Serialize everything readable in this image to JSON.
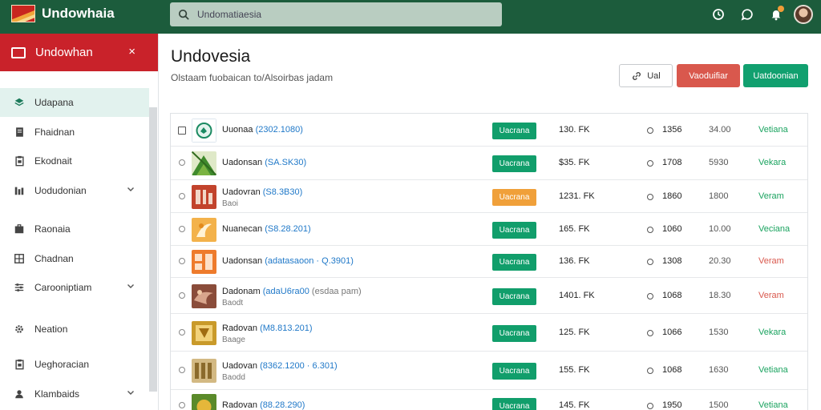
{
  "app": {
    "brand": "Undowhaia",
    "colors": {
      "topbar": "#1c5c3c",
      "sidebar_header": "#c9222a",
      "accent_green": "#11a06f",
      "accent_orange": "#f0a03a",
      "accent_red": "#d9584d"
    }
  },
  "search": {
    "value": "Undomatiaesia",
    "placeholder": "Undomatiaesia"
  },
  "topbar_icons": [
    "clock-icon",
    "chat-icon",
    "bell-icon"
  ],
  "sidebar": {
    "title": "Undowhan",
    "close": "×",
    "items": [
      {
        "label": "Udapana",
        "icon": "layers-icon",
        "active": true,
        "chevron": false
      },
      {
        "label": "Fhaidnan",
        "icon": "document-icon",
        "active": false,
        "chevron": false
      },
      {
        "label": "Ekodnait",
        "icon": "clipboard-icon",
        "active": false,
        "chevron": false
      },
      {
        "label": "Uodudonian",
        "icon": "bar-chart-icon",
        "active": false,
        "chevron": true
      },
      {
        "label": "Raonaia",
        "icon": "briefcase-icon",
        "active": false,
        "chevron": false
      },
      {
        "label": "Chadnan",
        "icon": "grid-icon",
        "active": false,
        "chevron": false
      },
      {
        "label": "Carooniptiam",
        "icon": "sliders-icon",
        "active": false,
        "chevron": true
      },
      {
        "label": "Neation",
        "icon": "gear-icon",
        "active": false,
        "chevron": false
      },
      {
        "label": "Ueghoracian",
        "icon": "clipboard-icon",
        "active": false,
        "chevron": false
      },
      {
        "label": "Klambaids",
        "icon": "user-icon",
        "active": false,
        "chevron": true
      }
    ]
  },
  "main": {
    "title": "Undovesia",
    "subtitle": "Olstaam fuobaican to/Alsoirbas jadam",
    "buttons": {
      "outline": "Ual",
      "red": "Vaoduifiar",
      "green": "Uatdoonian"
    }
  },
  "table": {
    "rows": [
      {
        "name": "Uuonaa",
        "code": "(2302.1080)",
        "tag": "",
        "status": "Uacrana",
        "status_color": "#119e6b",
        "price": "130. FK",
        "qty": "1356",
        "value": "34.00",
        "action": "Vetiana",
        "action_color": "#1aa35f",
        "thumb": "circle-logo"
      },
      {
        "name": "Uadonsan",
        "code": "(SA.SK30)",
        "tag": "",
        "status": "Uacrana",
        "status_color": "#119e6b",
        "price": "$35. FK",
        "qty": "1708",
        "value": "5930",
        "action": "Vekara",
        "action_color": "#1aa35f",
        "thumb": "green-tree"
      },
      {
        "name": "Uadovran",
        "code": "(S8.3B30)",
        "tag": "Baoi",
        "status": "Uacrana",
        "status_color": "#f0a03a",
        "price": "1231. FK",
        "qty": "1860",
        "value": "1800",
        "action": "Veram",
        "action_color": "#1aa35f",
        "thumb": "red-pattern"
      },
      {
        "name": "Nuanecan",
        "code": "(S8.28.201)",
        "tag": "",
        "status": "Uacrana",
        "status_color": "#119e6b",
        "price": "165. FK",
        "qty": "1060",
        "value": "10.00",
        "action": "Veciana",
        "action_color": "#1aa35f",
        "thumb": "orange-swirl"
      },
      {
        "name": "Uadonsan",
        "code": "(adatasaoon · Q.3901)",
        "tag": "",
        "status": "Uacrana",
        "status_color": "#119e6b",
        "price": "136. FK",
        "qty": "1308",
        "value": "20.30",
        "action": "Veram",
        "action_color": "#d9584d",
        "thumb": "orange-pattern"
      },
      {
        "name": "Dadonam",
        "code": "(adaU6ra00",
        "tag": "Baodt",
        "extra": "(esdaa pam)",
        "status": "Uacrana",
        "status_color": "#119e6b",
        "price": "1401. FK",
        "qty": "1068",
        "value": "18.30",
        "action": "Veram",
        "action_color": "#d9584d",
        "thumb": "brown-art"
      },
      {
        "name": "Radovan",
        "code": "(M8.813.201)",
        "tag": "Baage",
        "status": "Uacrana",
        "status_color": "#119e6b",
        "price": "125. FK",
        "qty": "1066",
        "value": "1530",
        "action": "Vekara",
        "action_color": "#1aa35f",
        "thumb": "gold-tile"
      },
      {
        "name": "Uadovan",
        "code": "(8362.1200 · 6.301)",
        "tag": "Baodd",
        "status": "Uacrana",
        "status_color": "#119e6b",
        "price": "155. FK",
        "qty": "1068",
        "value": "1630",
        "action": "Vetiana",
        "action_color": "#1aa35f",
        "thumb": "gold-bars"
      },
      {
        "name": "Radovan",
        "code": "(88.28.290)",
        "tag": "",
        "status": "Uacrana",
        "status_color": "#119e6b",
        "price": "145. FK",
        "qty": "1950",
        "value": "1500",
        "action": "Vetiana",
        "action_color": "#1aa35f",
        "thumb": "gold-green"
      }
    ]
  }
}
